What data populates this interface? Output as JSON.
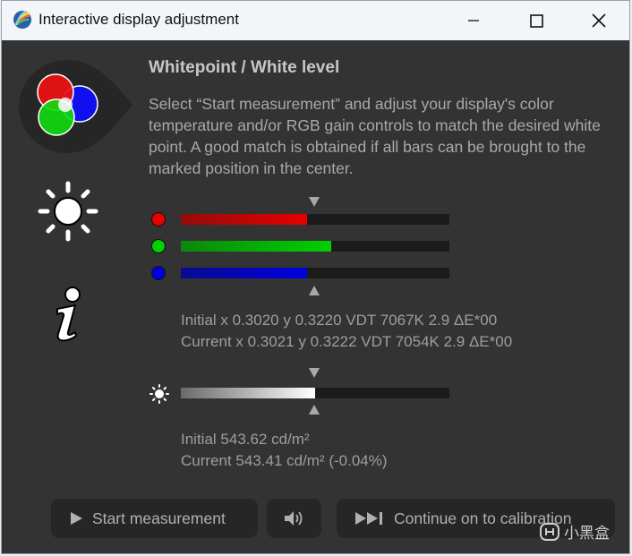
{
  "window": {
    "title": "Interactive display adjustment"
  },
  "heading": "Whitepoint / White level",
  "description": "Select “Start measurement” and adjust your display's color temperature and/or RGB gain controls to match the desired white point. A good match is obtained if all bars can be brought to the marked position in the center.",
  "rgb_bars": [
    {
      "channel": "red",
      "color": "#e60000",
      "fill_fraction": 0.47
    },
    {
      "channel": "green",
      "color": "#00d000",
      "fill_fraction": 0.56
    },
    {
      "channel": "blue",
      "color": "#0000e0",
      "fill_fraction": 0.47
    }
  ],
  "whitepoint": {
    "initial": "Initial x 0.3020 y 0.3220 VDT 7067K 2.9 ΔE*00",
    "current": "Current x 0.3021 y 0.3222 VDT 7054K 2.9 ΔE*00"
  },
  "luminance_bar": {
    "fill_fraction": 0.5
  },
  "luminance": {
    "initial": "Initial 543.62 cd/m²",
    "current": "Current 543.41 cd/m² (-0.04%)"
  },
  "buttons": {
    "start": "Start measurement",
    "continue": "Continue on to calibration"
  },
  "icons": {
    "title_app": "rainbow-leaf-icon",
    "side_rgb": "rgb-circles-icon",
    "side_brightness": "sun-icon",
    "side_info": "info-icon"
  },
  "watermark": "小黑盒"
}
